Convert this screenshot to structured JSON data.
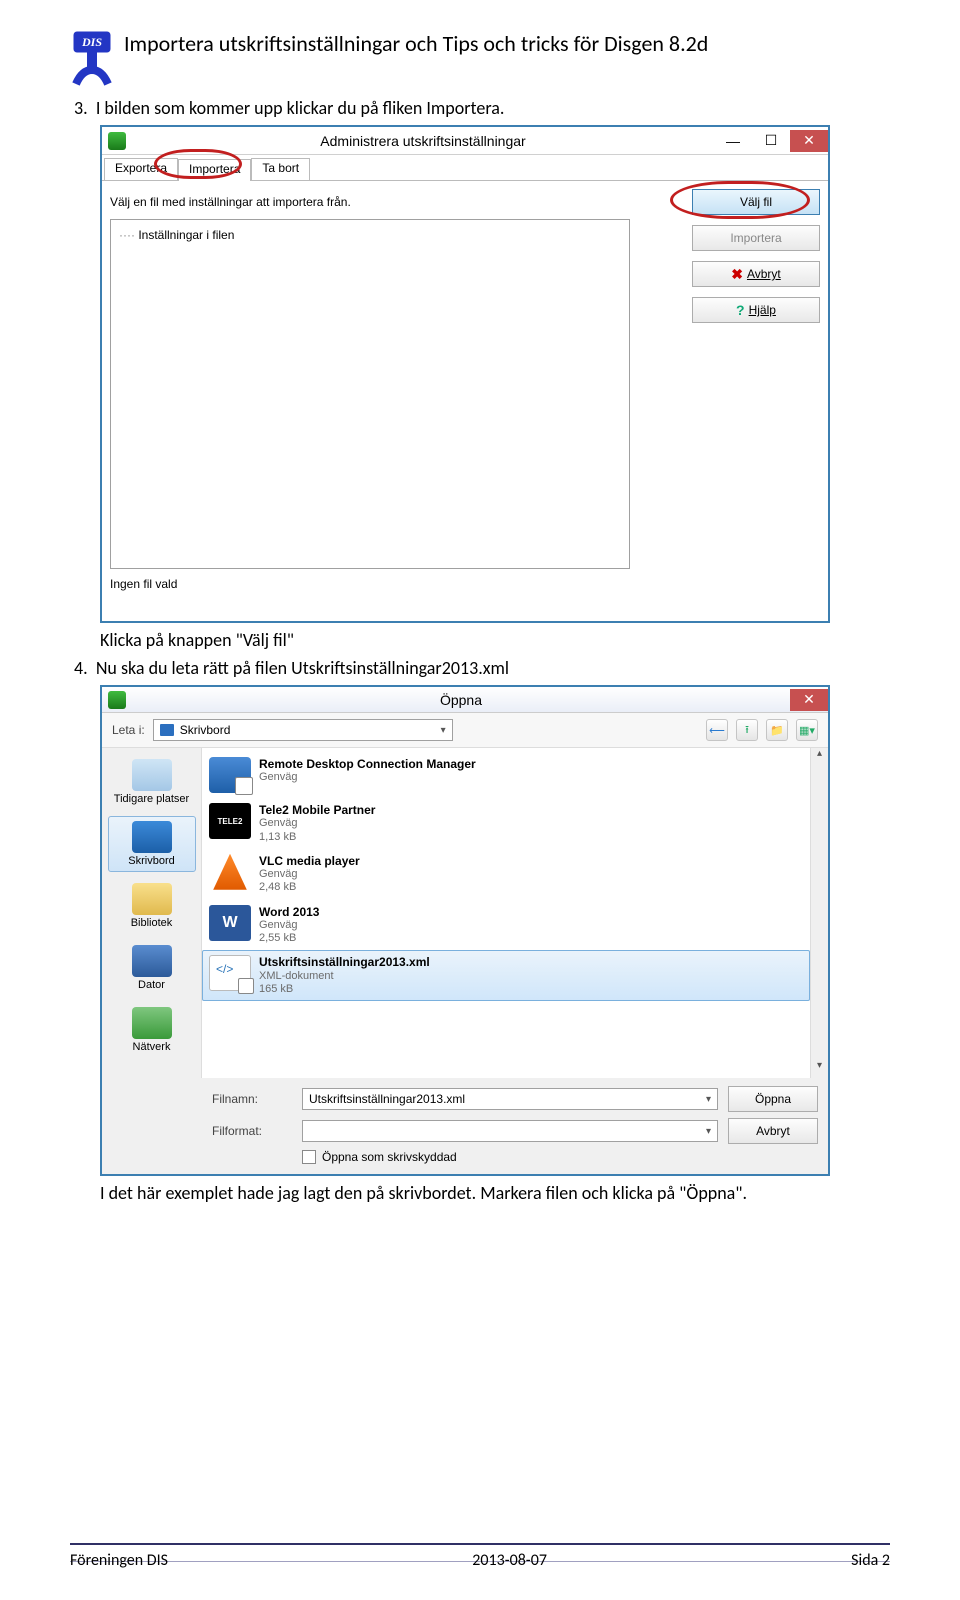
{
  "logo_text": "DIS",
  "doc_title": "Importera utskriftsinställningar och Tips och tricks för Disgen 8.2d",
  "step3_num": "3.",
  "step3_text": "I bilden som kommer upp klickar du på fliken Importera.",
  "step3b_text": "Klicka på knappen \"Välj fil\"",
  "step4_num": "4.",
  "step4_text": "Nu ska du leta rätt på filen Utskriftsinställningar2013.xml",
  "step4b_text": "I det här exemplet hade jag lagt den på skrivbordet. Markera filen och klicka på \"Öppna\".",
  "win1": {
    "title": "Administrera utskriftsinställningar",
    "min": "—",
    "max": "☐",
    "close": "✕",
    "tabs": {
      "export": "Exportera",
      "import": "Importera",
      "del": "Ta bort"
    },
    "instr": "Välj en fil med inställningar att importera från.",
    "tree_item": "Inställningar i filen",
    "no_file": "Ingen fil vald",
    "btn_choose": "Välj fil",
    "btn_import": "Importera",
    "btn_cancel": "Avbryt",
    "btn_help": "Hjälp"
  },
  "win2": {
    "title": "Öppna",
    "close": "✕",
    "look_in_lbl": "Leta i:",
    "look_in_val": "Skrivbord",
    "places": {
      "recent": "Tidigare platser",
      "desktop": "Skrivbord",
      "library": "Bibliotek",
      "computer": "Dator",
      "network": "Nätverk"
    },
    "files": [
      {
        "name": "Remote Desktop Connection Manager",
        "type": "Genväg",
        "size": ""
      },
      {
        "name": "Tele2 Mobile Partner",
        "type": "Genväg",
        "size": "1,13 kB",
        "tele2": "TELE2"
      },
      {
        "name": "VLC media player",
        "type": "Genväg",
        "size": "2,48 kB"
      },
      {
        "name": "Word 2013",
        "type": "Genväg",
        "size": "2,55 kB"
      },
      {
        "name": "Utskriftsinställningar2013.xml",
        "type": "XML-dokument",
        "size": "165 kB"
      }
    ],
    "filename_lbl": "Filnamn:",
    "filename_val": "Utskriftsinställningar2013.xml",
    "filetype_lbl": "Filformat:",
    "btn_open": "Öppna",
    "btn_cancel": "Avbryt",
    "chk_readonly": "Öppna som skrivskyddad"
  },
  "footer": {
    "left": "Föreningen DIS",
    "center": "2013-08-07",
    "right": "Sida 2"
  }
}
